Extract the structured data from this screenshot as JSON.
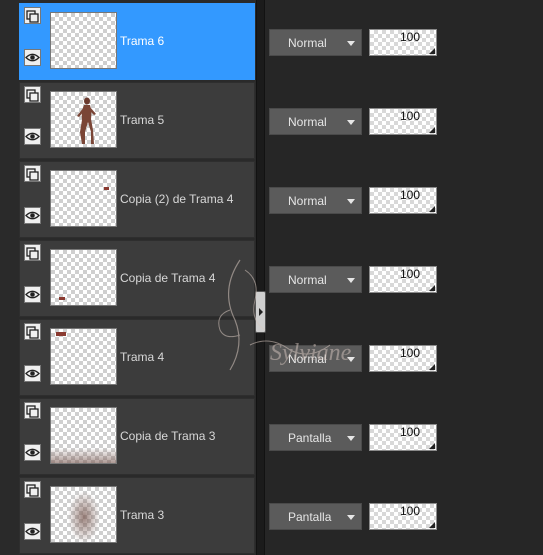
{
  "layers": [
    {
      "name": "Trama 6",
      "blend": "Normal",
      "opacity": "100",
      "selected": true,
      "thumb": "empty"
    },
    {
      "name": "Trama 5",
      "blend": "Normal",
      "opacity": "100",
      "selected": false,
      "thumb": "figure"
    },
    {
      "name": "Copia (2) de Trama 4",
      "blend": "Normal",
      "opacity": "100",
      "selected": false,
      "thumb": "speck-right"
    },
    {
      "name": "Copia de Trama 4",
      "blend": "Normal",
      "opacity": "100",
      "selected": false,
      "thumb": "speck-left"
    },
    {
      "name": "Trama 4",
      "blend": "Normal",
      "opacity": "100",
      "selected": false,
      "thumb": "speck-top"
    },
    {
      "name": "Copia de Trama 3",
      "blend": "Pantalla",
      "opacity": "100",
      "selected": false,
      "thumb": "bottom-blur"
    },
    {
      "name": "Trama 3",
      "blend": "Pantalla",
      "opacity": "100",
      "selected": false,
      "thumb": "center-blur"
    }
  ],
  "watermark": "Sylviane",
  "colors": {
    "selected": "#3399ff",
    "row": "#3c3c3c",
    "dropdown": "#5b5b5b"
  },
  "icons": {
    "lock": "lock-layer-icon",
    "eye": "visibility-eye-icon"
  }
}
